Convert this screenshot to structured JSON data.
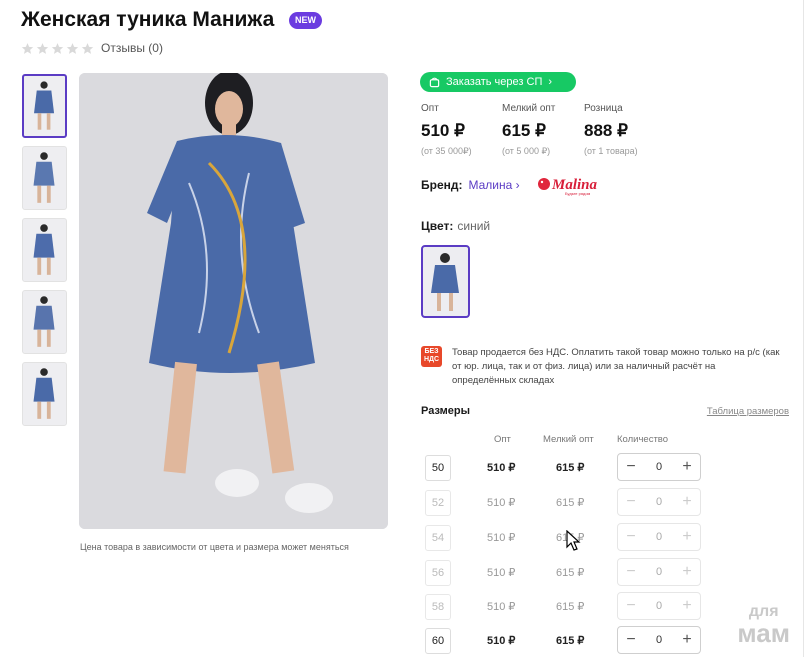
{
  "product": {
    "title": "Женская туника Манижа",
    "badge": "NEW"
  },
  "rating": {
    "stars": 0,
    "reviews_label": "Отзывы (0)"
  },
  "gallery": {
    "thumb_count": 5,
    "note": "Цена товара в зависимости от цвета и размера может меняться"
  },
  "sp_button": {
    "label": "Заказать через СП"
  },
  "prices": [
    {
      "label": "Опт",
      "value": "510 ₽",
      "sub": "(от 35 000₽)"
    },
    {
      "label": "Мелкий опт",
      "value": "615 ₽",
      "sub": "(от 5 000 ₽)"
    },
    {
      "label": "Розница",
      "value": "888 ₽",
      "sub": "(от 1 товара)"
    }
  ],
  "brand": {
    "label": "Бренд:",
    "name": "Малина",
    "logo_text": "Malina",
    "logo_sub": "Будьте рядом"
  },
  "color": {
    "label": "Цвет:",
    "value": "синий"
  },
  "vat": {
    "badge_lines": [
      "БЕЗ",
      "НДС"
    ],
    "text": "Товар продается без НДС. Оплатить такой товар можно только на р/с (как от юр. лица, так и от физ. лица) или за наличный расчёт на определённых складах"
  },
  "sizes": {
    "title": "Размеры",
    "table_link": "Таблица размеров",
    "headers": {
      "opt": "Опт",
      "small_opt": "Мелкий опт",
      "qty": "Количество"
    },
    "rows": [
      {
        "size": "50",
        "opt": "510 ₽",
        "small": "615 ₽",
        "qty": "0",
        "available": true
      },
      {
        "size": "52",
        "opt": "510 ₽",
        "small": "615 ₽",
        "qty": "0",
        "available": false
      },
      {
        "size": "54",
        "opt": "510 ₽",
        "small": "615 ₽",
        "qty": "0",
        "available": false
      },
      {
        "size": "56",
        "opt": "510 ₽",
        "small": "615 ₽",
        "qty": "0",
        "available": false
      },
      {
        "size": "58",
        "opt": "510 ₽",
        "small": "615 ₽",
        "qty": "0",
        "available": false
      },
      {
        "size": "60",
        "opt": "510 ₽",
        "small": "615 ₽",
        "qty": "0",
        "available": true
      }
    ]
  },
  "watermark": {
    "line1": "для",
    "line2": "мам"
  },
  "colors": {
    "accent": "#5b3cc4",
    "green": "#17c964",
    "badge_red": "#e8482a",
    "dress_blue": "#4a6aa8"
  }
}
